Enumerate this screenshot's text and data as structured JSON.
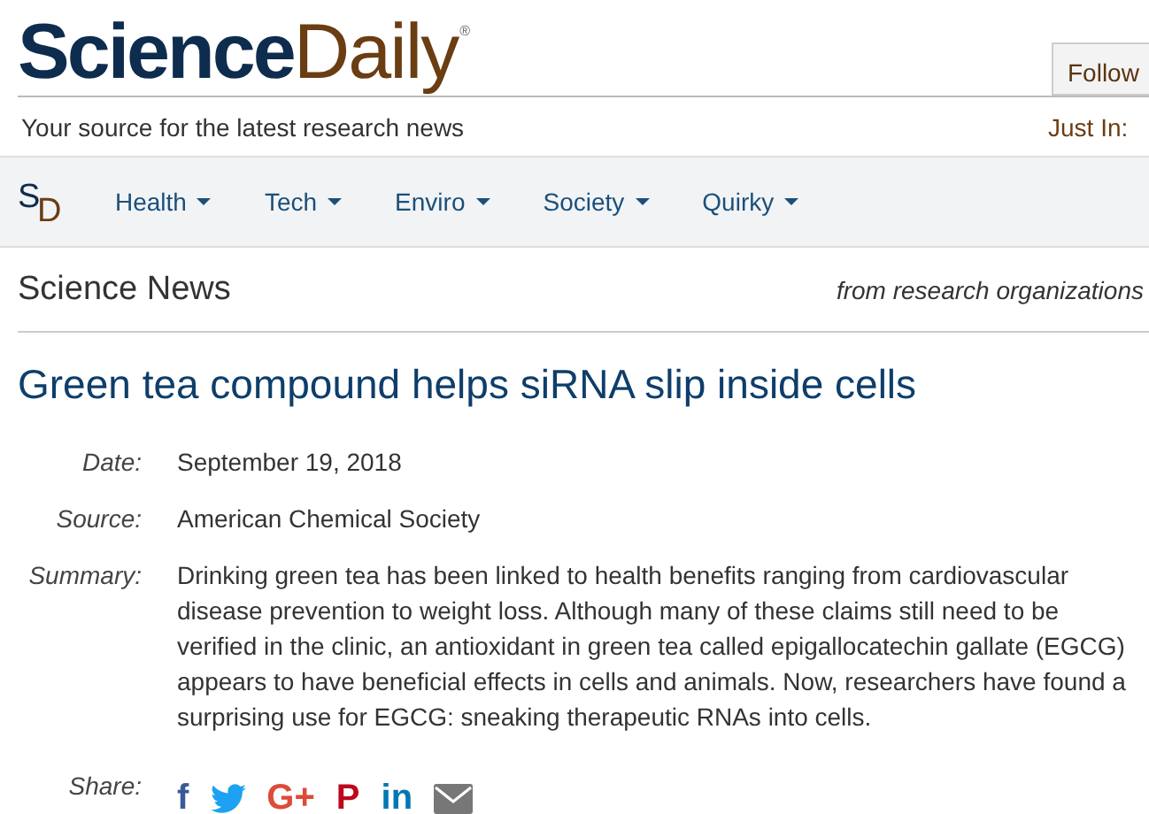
{
  "header": {
    "logo": [
      "Science",
      "Daily",
      "®"
    ],
    "tagline": "Your source for the latest research news",
    "follow_button": "Follow",
    "just_in": "Just In:"
  },
  "nav": {
    "logo": [
      "S",
      "D"
    ],
    "items": [
      {
        "label": "Health"
      },
      {
        "label": "Tech"
      },
      {
        "label": "Enviro"
      },
      {
        "label": "Society"
      },
      {
        "label": "Quirky"
      }
    ]
  },
  "section": {
    "title": "Science News",
    "subtitle": "from research organizations"
  },
  "article": {
    "headline": "Green tea compound helps siRNA slip inside cells",
    "meta": [
      {
        "label": "Date:",
        "value": "September 19, 2018"
      },
      {
        "label": "Source:",
        "value": "American Chemical Society"
      },
      {
        "label": "Summary:",
        "value": "Drinking green tea has been linked to health benefits ranging from cardiovascular disease prevention to weight loss. Although many of these claims still need to be verified in the clinic, an antioxidant in green tea called epigallocatechin gallate (EGCG) appears to have beneficial effects in cells and animals. Now, researchers have found a surprising use for EGCG: sneaking therapeutic RNAs into cells."
      }
    ],
    "share_label": "Share:",
    "share": [
      {
        "kind": "glyph",
        "text": "f",
        "color": "#3b5998"
      },
      {
        "kind": "bird",
        "color": "#1da1f2"
      },
      {
        "kind": "glyph",
        "text": "G+",
        "color": "#dd4b39"
      },
      {
        "kind": "glyph",
        "text": "P",
        "color": "#bd081c"
      },
      {
        "kind": "glyph",
        "text": "in",
        "color": "#0077b5"
      },
      {
        "kind": "mail",
        "color": "#777777"
      }
    ]
  }
}
